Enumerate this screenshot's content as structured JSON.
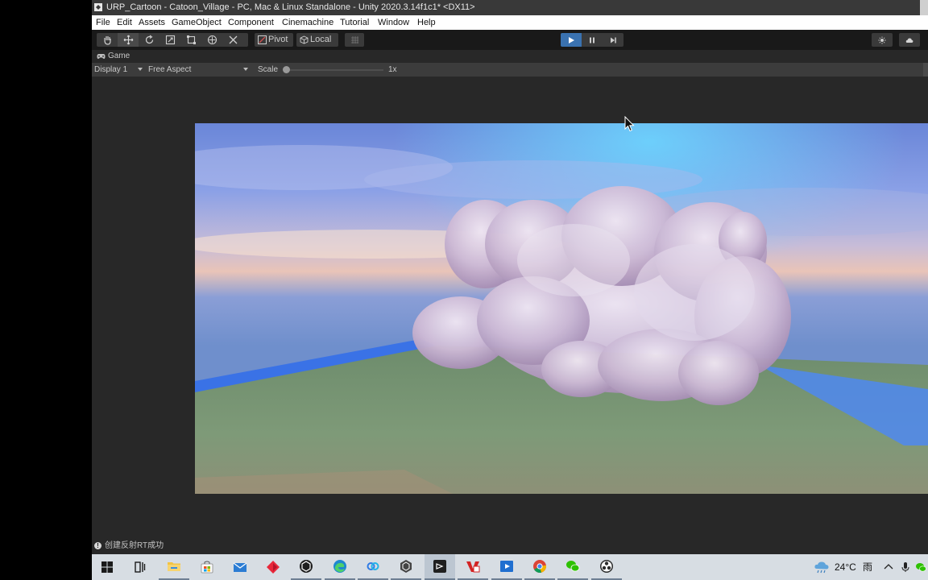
{
  "window": {
    "title": "URP_Cartoon - Catoon_Village - PC, Mac & Linux Standalone - Unity 2020.3.14f1c1* <DX11>"
  },
  "menu": [
    "File",
    "Edit",
    "Assets",
    "GameObject",
    "Component",
    "Cinemachine",
    "Tutorial",
    "Window",
    "Help"
  ],
  "toolbar": {
    "tools": [
      "hand-icon",
      "move-icon",
      "rotate-icon",
      "scale-icon",
      "rect-icon",
      "transform-icon",
      "custom-tool-icon"
    ],
    "active_tool": "move-icon",
    "pivot_label": "Pivot",
    "local_label": "Local",
    "play_state": "playing",
    "accent": "#3a72b0"
  },
  "game_tab": {
    "label": "Game"
  },
  "game_bar": {
    "display": "Display 1",
    "aspect": "Free Aspect",
    "scale_label": "Scale",
    "scale_value": "1x"
  },
  "status": {
    "message": "创建反射RT成功"
  },
  "taskbar": {
    "apps": [
      "windows-start-icon",
      "task-view-icon",
      "file-explorer-icon",
      "store-icon",
      "mail-icon",
      "red-diamond-app-icon",
      "unity-hub-icon",
      "edge-icon",
      "baidu-netdisk-icon",
      "unity-icon",
      "visual-studio-icon",
      "vpn-app-icon",
      "video-app-icon",
      "chrome-icon",
      "wechat-icon",
      "obs-icon"
    ],
    "temperature": "24°C",
    "weather": "雨"
  }
}
